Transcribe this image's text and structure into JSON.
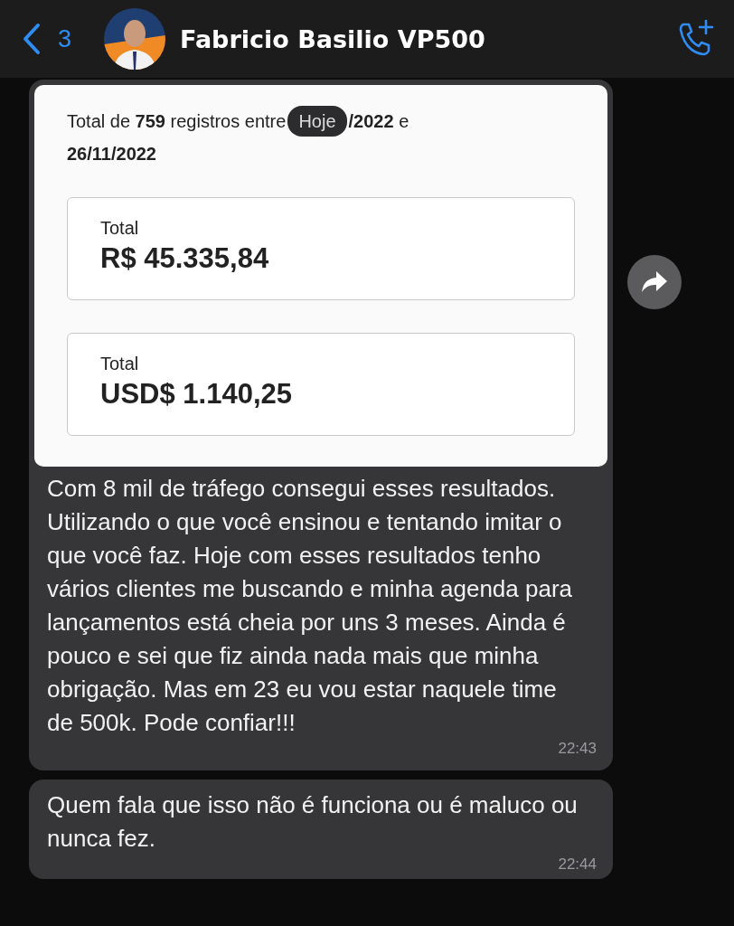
{
  "header": {
    "back_count": "3",
    "contact_name": "Fabricio Basilio VP500"
  },
  "date_badge": "Hoje",
  "messages": [
    {
      "kind": "image",
      "screenshot": {
        "summary_before": "Total de **759** registros entre",
        "summary_after": "**/2022** e",
        "summary_end": "**26/11/2022**",
        "totals": [
          {
            "label": "Total",
            "value": "R$ 45.335,84"
          },
          {
            "label": "Total",
            "value": "USD$ 1.140,25"
          }
        ]
      },
      "text": "Com 8 mil de tráfego consegui esses resultados. Utilizando o que você ensinou e tentando imitar o que você faz. Hoje com esses resultados tenho vários clientes me buscando e minha agenda para lançamentos está cheia por uns 3 meses. Ainda é pouco e sei que fiz ainda nada mais que minha obrigação. Mas em 23 eu vou estar naquele time de 500k. Pode confiar!!!",
      "time": "22:43"
    },
    {
      "kind": "text",
      "text": "Quem fala que isso não é funciona ou é maluco ou nunca fez.",
      "time": "22:44"
    }
  ]
}
